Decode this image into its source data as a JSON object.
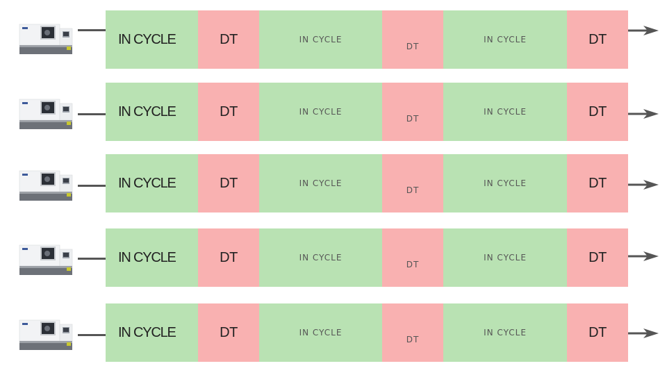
{
  "diagram": {
    "arrow_color": "#555555",
    "colors": {
      "in_cycle": "#b9e2b3",
      "downtime": "#f9b1b1"
    },
    "rows": [
      {
        "machine_icon": "cnc-lathe-icon",
        "segments": [
          {
            "label": "IN CYCLE",
            "state": "in_cycle"
          },
          {
            "label": "DT",
            "state": "downtime"
          },
          {
            "label": "IN CYCLE",
            "state": "in_cycle"
          },
          {
            "label": "DT",
            "state": "downtime"
          },
          {
            "label": "IN CYCLE",
            "state": "in_cycle"
          },
          {
            "label": "DT",
            "state": "downtime"
          }
        ]
      },
      {
        "machine_icon": "cnc-lathe-icon",
        "segments": [
          {
            "label": "IN CYCLE",
            "state": "in_cycle"
          },
          {
            "label": "DT",
            "state": "downtime"
          },
          {
            "label": "IN CYCLE",
            "state": "in_cycle"
          },
          {
            "label": "DT",
            "state": "downtime"
          },
          {
            "label": "IN CYCLE",
            "state": "in_cycle"
          },
          {
            "label": "DT",
            "state": "downtime"
          }
        ]
      },
      {
        "machine_icon": "cnc-lathe-icon",
        "segments": [
          {
            "label": "IN CYCLE",
            "state": "in_cycle"
          },
          {
            "label": "DT",
            "state": "downtime"
          },
          {
            "label": "IN CYCLE",
            "state": "in_cycle"
          },
          {
            "label": "DT",
            "state": "downtime"
          },
          {
            "label": "IN CYCLE",
            "state": "in_cycle"
          },
          {
            "label": "DT",
            "state": "downtime"
          }
        ]
      },
      {
        "machine_icon": "cnc-lathe-icon",
        "segments": [
          {
            "label": "IN CYCLE",
            "state": "in_cycle"
          },
          {
            "label": "DT",
            "state": "downtime"
          },
          {
            "label": "IN CYCLE",
            "state": "in_cycle"
          },
          {
            "label": "DT",
            "state": "downtime"
          },
          {
            "label": "IN CYCLE",
            "state": "in_cycle"
          },
          {
            "label": "DT",
            "state": "downtime"
          }
        ]
      },
      {
        "machine_icon": "cnc-lathe-icon",
        "segments": [
          {
            "label": "IN CYCLE",
            "state": "in_cycle"
          },
          {
            "label": "DT",
            "state": "downtime"
          },
          {
            "label": "IN CYCLE",
            "state": "in_cycle"
          },
          {
            "label": "DT",
            "state": "downtime"
          },
          {
            "label": "IN CYCLE",
            "state": "in_cycle"
          },
          {
            "label": "DT",
            "state": "downtime"
          }
        ]
      }
    ]
  }
}
